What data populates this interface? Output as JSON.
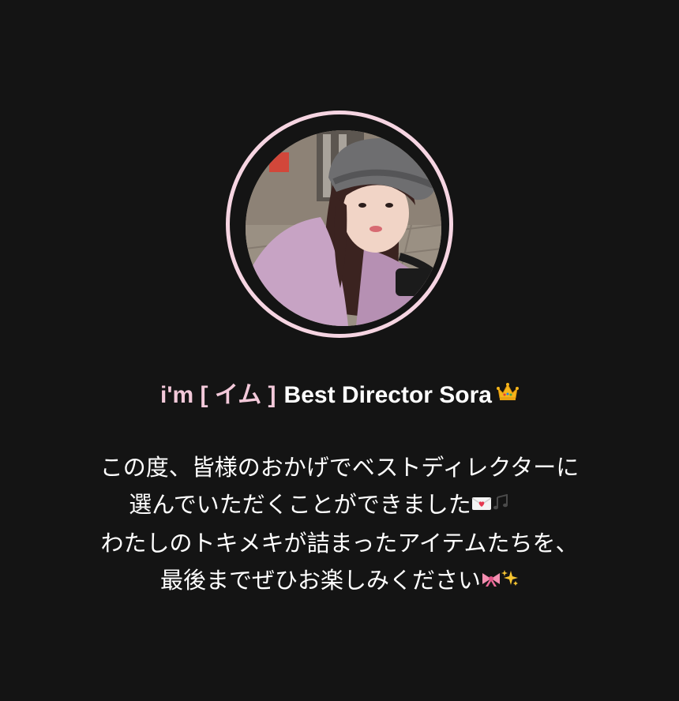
{
  "profile": {
    "brand_name": "i'm [ イム ]",
    "director_title": "Best Director Sora",
    "title_icon": "crown-icon",
    "avatar": {
      "description": "profile-photo",
      "ring_color": "#f6d5e2"
    }
  },
  "message": {
    "lines": [
      "この度、皆様のおかげでベストディレクターに",
      "選んでいただくことができました",
      "わたしのトキメキが詰まったアイテムたちを、",
      "最後までぜひお楽しみください"
    ],
    "line2_icons": [
      "love-letter-icon",
      "music-notes-icon"
    ],
    "line4_icons": [
      "ribbon-icon",
      "sparkles-icon"
    ]
  },
  "colors": {
    "background": "#141414",
    "brand_pink": "#f3c9da",
    "text": "#ffffff"
  }
}
